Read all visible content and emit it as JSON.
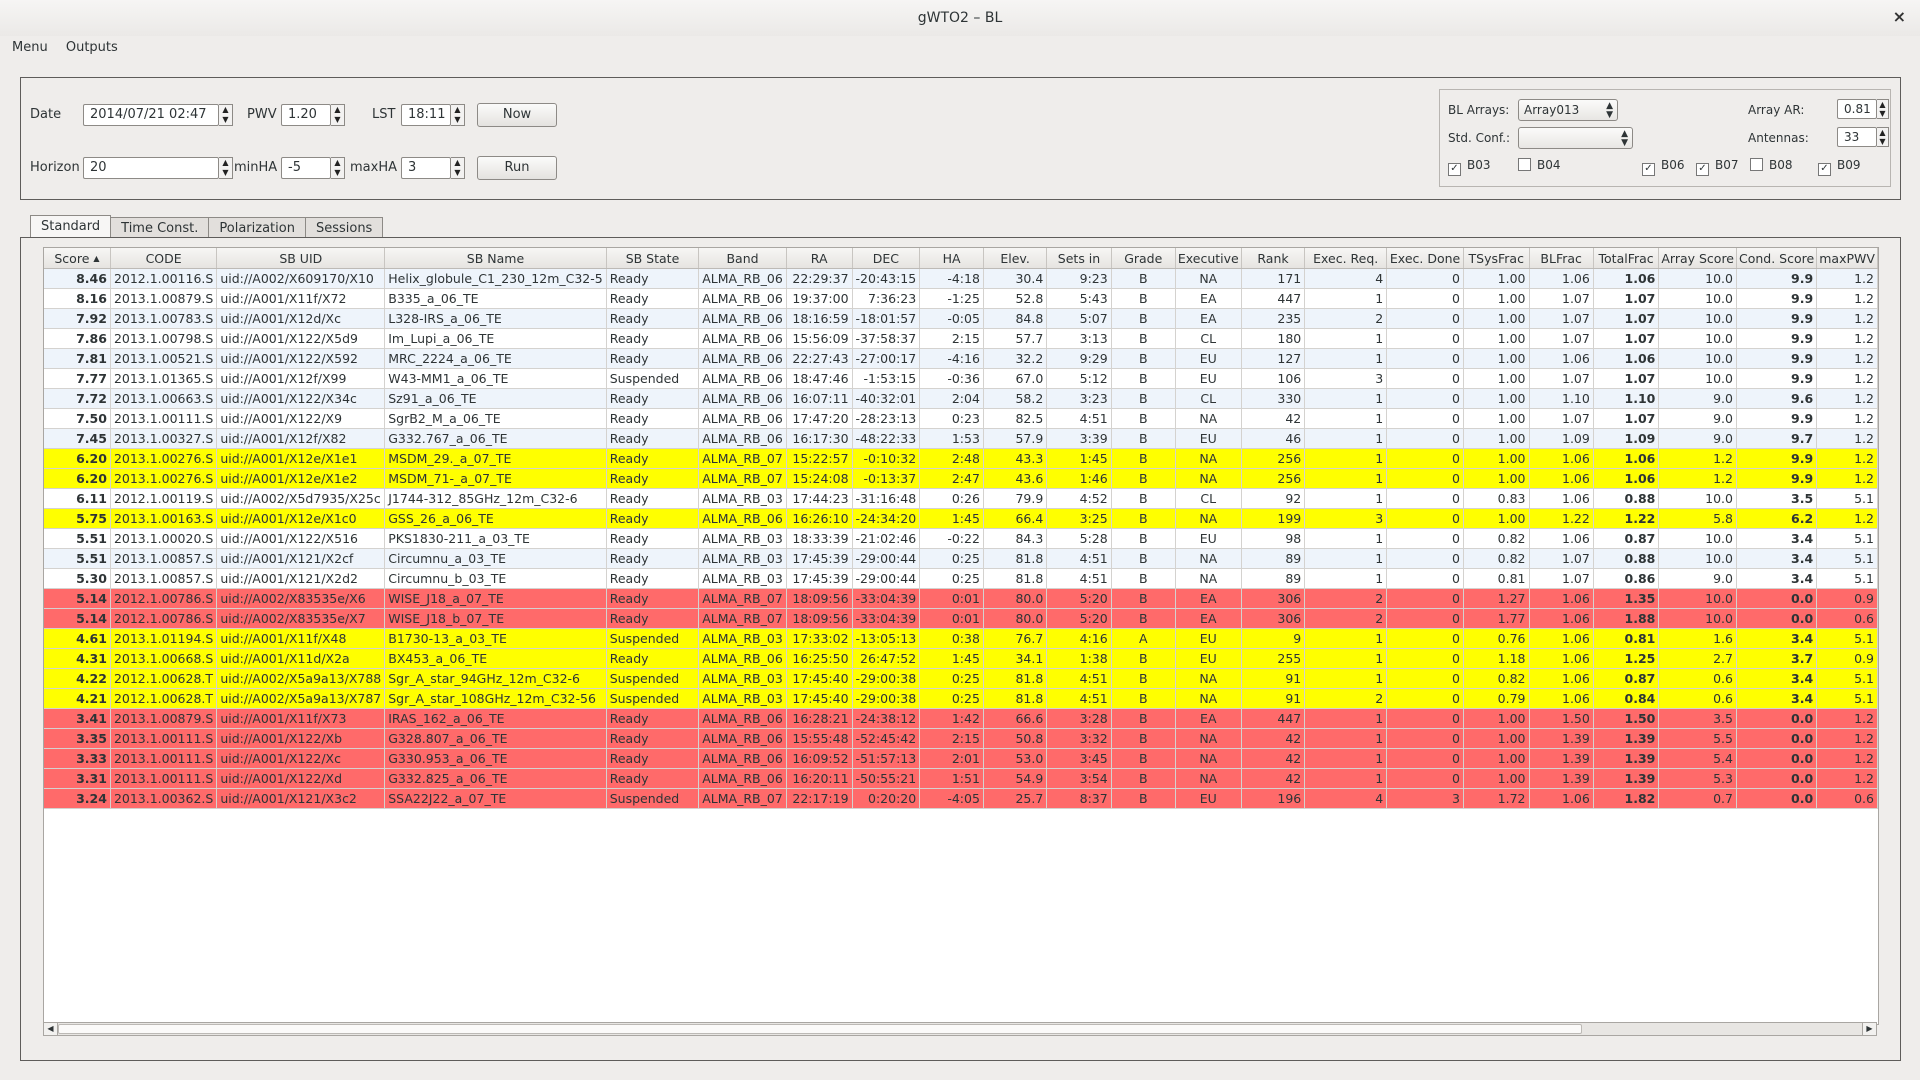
{
  "window": {
    "title": "gWTO2 – BL",
    "close_glyph": "×"
  },
  "menu": [
    "Menu",
    "Outputs"
  ],
  "controls": {
    "date_label": "Date",
    "date_value": "2014/07/21 02:47",
    "pwv_label": "PWV",
    "pwv_value": "1.20",
    "lst_label": "LST",
    "lst_value": "18:11",
    "now_button": "Now",
    "horizon_label": "Horizon",
    "horizon_value": "20",
    "minha_label": "minHA",
    "minha_value": "-5",
    "maxha_label": "maxHA",
    "maxha_value": "3",
    "run_button": "Run"
  },
  "bl_panel": {
    "arrays_label": "BL Arrays:",
    "arrays_value": "Array013",
    "std_conf_label": "Std. Conf.:",
    "std_conf_value": "",
    "array_ar_label": "Array AR:",
    "array_ar_value": "0.81",
    "antennas_label": "Antennas:",
    "antennas_value": "33",
    "checkboxes": [
      {
        "label": "B03",
        "checked": true
      },
      {
        "label": "B04",
        "checked": false
      },
      {
        "label": "B06",
        "checked": true
      },
      {
        "label": "B07",
        "checked": true
      },
      {
        "label": "B08",
        "checked": false
      },
      {
        "label": "B09",
        "checked": true
      }
    ]
  },
  "tabs": [
    "Standard",
    "Time Const.",
    "Polarization",
    "Sessions"
  ],
  "table": {
    "sort_indicator": "▲",
    "columns": [
      "Score",
      "CODE",
      "SB UID",
      "SB Name",
      "SB State",
      "Band",
      "RA",
      "DEC",
      "HA",
      "Elev.",
      "Sets in",
      "Grade",
      "Executive",
      "Rank",
      "Exec. Req.",
      "Exec. Done",
      "TSysFrac",
      "BLFrac",
      "TotalFrac",
      "Array Score",
      "Cond. Score",
      "maxPWV"
    ],
    "rows": [
      {
        "color": "alt",
        "cells": [
          "8.46",
          "2012.1.00116.S",
          "uid://A002/X609170/X10",
          "Helix_globule_C1_230_12m_C32-5",
          "Ready",
          "ALMA_RB_06",
          "22:29:37",
          "-20:43:15",
          "-4:18",
          "30.4",
          "9:23",
          "B",
          "NA",
          "171",
          "4",
          "0",
          "1.00",
          "1.06",
          "1.06",
          "10.0",
          "9.9",
          "1.2"
        ]
      },
      {
        "color": "plain",
        "cells": [
          "8.16",
          "2013.1.00879.S",
          "uid://A001/X11f/X72",
          "B335_a_06_TE",
          "Ready",
          "ALMA_RB_06",
          "19:37:00",
          "7:36:23",
          "-1:25",
          "52.8",
          "5:43",
          "B",
          "EA",
          "447",
          "1",
          "0",
          "1.00",
          "1.07",
          "1.07",
          "10.0",
          "9.9",
          "1.2"
        ]
      },
      {
        "color": "alt",
        "cells": [
          "7.92",
          "2013.1.00783.S",
          "uid://A001/X12d/Xc",
          "L328-IRS_a_06_TE",
          "Ready",
          "ALMA_RB_06",
          "18:16:59",
          "-18:01:57",
          "-0:05",
          "84.8",
          "5:07",
          "B",
          "EA",
          "235",
          "2",
          "0",
          "1.00",
          "1.07",
          "1.07",
          "10.0",
          "9.9",
          "1.2"
        ]
      },
      {
        "color": "plain",
        "cells": [
          "7.86",
          "2013.1.00798.S",
          "uid://A001/X122/X5d9",
          "Im_Lupi_a_06_TE",
          "Ready",
          "ALMA_RB_06",
          "15:56:09",
          "-37:58:37",
          "2:15",
          "57.7",
          "3:13",
          "B",
          "CL",
          "180",
          "1",
          "0",
          "1.00",
          "1.07",
          "1.07",
          "10.0",
          "9.9",
          "1.2"
        ]
      },
      {
        "color": "alt",
        "cells": [
          "7.81",
          "2013.1.00521.S",
          "uid://A001/X122/X592",
          "MRC_2224_a_06_TE",
          "Ready",
          "ALMA_RB_06",
          "22:27:43",
          "-27:00:17",
          "-4:16",
          "32.2",
          "9:29",
          "B",
          "EU",
          "127",
          "1",
          "0",
          "1.00",
          "1.06",
          "1.06",
          "10.0",
          "9.9",
          "1.2"
        ]
      },
      {
        "color": "plain",
        "cells": [
          "7.77",
          "2013.1.01365.S",
          "uid://A001/X12f/X99",
          "W43-MM1_a_06_TE",
          "Suspended",
          "ALMA_RB_06",
          "18:47:46",
          "-1:53:15",
          "-0:36",
          "67.0",
          "5:12",
          "B",
          "EU",
          "106",
          "3",
          "0",
          "1.00",
          "1.07",
          "1.07",
          "10.0",
          "9.9",
          "1.2"
        ]
      },
      {
        "color": "alt",
        "cells": [
          "7.72",
          "2013.1.00663.S",
          "uid://A001/X122/X34c",
          "Sz91_a_06_TE",
          "Ready",
          "ALMA_RB_06",
          "16:07:11",
          "-40:32:01",
          "2:04",
          "58.2",
          "3:23",
          "B",
          "CL",
          "330",
          "1",
          "0",
          "1.00",
          "1.10",
          "1.10",
          "9.0",
          "9.6",
          "1.2"
        ]
      },
      {
        "color": "plain",
        "cells": [
          "7.50",
          "2013.1.00111.S",
          "uid://A001/X122/X9",
          "SgrB2_M_a_06_TE",
          "Ready",
          "ALMA_RB_06",
          "17:47:20",
          "-28:23:13",
          "0:23",
          "82.5",
          "4:51",
          "B",
          "NA",
          "42",
          "1",
          "0",
          "1.00",
          "1.07",
          "1.07",
          "9.0",
          "9.9",
          "1.2"
        ]
      },
      {
        "color": "alt",
        "cells": [
          "7.45",
          "2013.1.00327.S",
          "uid://A001/X12f/X82",
          "G332.767_a_06_TE",
          "Ready",
          "ALMA_RB_06",
          "16:17:30",
          "-48:22:33",
          "1:53",
          "57.9",
          "3:39",
          "B",
          "EU",
          "46",
          "1",
          "0",
          "1.00",
          "1.09",
          "1.09",
          "9.0",
          "9.7",
          "1.2"
        ]
      },
      {
        "color": "yellow",
        "cells": [
          "6.20",
          "2013.1.00276.S",
          "uid://A001/X12e/X1e1",
          "MSDM_29._a_07_TE",
          "Ready",
          "ALMA_RB_07",
          "15:22:57",
          "-0:10:32",
          "2:48",
          "43.3",
          "1:45",
          "B",
          "NA",
          "256",
          "1",
          "0",
          "1.00",
          "1.06",
          "1.06",
          "1.2",
          "9.9",
          "1.2"
        ]
      },
      {
        "color": "yellow",
        "cells": [
          "6.20",
          "2013.1.00276.S",
          "uid://A001/X12e/X1e2",
          "MSDM_71-_a_07_TE",
          "Ready",
          "ALMA_RB_07",
          "15:24:08",
          "-0:13:37",
          "2:47",
          "43.6",
          "1:46",
          "B",
          "NA",
          "256",
          "1",
          "0",
          "1.00",
          "1.06",
          "1.06",
          "1.2",
          "9.9",
          "1.2"
        ]
      },
      {
        "color": "plain",
        "cells": [
          "6.11",
          "2012.1.00119.S",
          "uid://A002/X5d7935/X25c",
          "J1744-312_85GHz_12m_C32-6",
          "Ready",
          "ALMA_RB_03",
          "17:44:23",
          "-31:16:48",
          "0:26",
          "79.9",
          "4:52",
          "B",
          "CL",
          "92",
          "1",
          "0",
          "0.83",
          "1.06",
          "0.88",
          "10.0",
          "3.5",
          "5.1"
        ]
      },
      {
        "color": "yellow",
        "cells": [
          "5.75",
          "2013.1.00163.S",
          "uid://A001/X12e/X1c0",
          "GSS_26_a_06_TE",
          "Ready",
          "ALMA_RB_06",
          "16:26:10",
          "-24:34:20",
          "1:45",
          "66.4",
          "3:25",
          "B",
          "NA",
          "199",
          "3",
          "0",
          "1.00",
          "1.22",
          "1.22",
          "5.8",
          "6.2",
          "1.2"
        ]
      },
      {
        "color": "plain",
        "cells": [
          "5.51",
          "2013.1.00020.S",
          "uid://A001/X122/X516",
          "PKS1830-211_a_03_TE",
          "Ready",
          "ALMA_RB_03",
          "18:33:39",
          "-21:02:46",
          "-0:22",
          "84.3",
          "5:28",
          "B",
          "EU",
          "98",
          "1",
          "0",
          "0.82",
          "1.06",
          "0.87",
          "10.0",
          "3.4",
          "5.1"
        ]
      },
      {
        "color": "alt",
        "cells": [
          "5.51",
          "2013.1.00857.S",
          "uid://A001/X121/X2cf",
          "Circumnu_a_03_TE",
          "Ready",
          "ALMA_RB_03",
          "17:45:39",
          "-29:00:44",
          "0:25",
          "81.8",
          "4:51",
          "B",
          "NA",
          "89",
          "1",
          "0",
          "0.82",
          "1.07",
          "0.88",
          "10.0",
          "3.4",
          "5.1"
        ]
      },
      {
        "color": "plain",
        "cells": [
          "5.30",
          "2013.1.00857.S",
          "uid://A001/X121/X2d2",
          "Circumnu_b_03_TE",
          "Ready",
          "ALMA_RB_03",
          "17:45:39",
          "-29:00:44",
          "0:25",
          "81.8",
          "4:51",
          "B",
          "NA",
          "89",
          "1",
          "0",
          "0.81",
          "1.07",
          "0.86",
          "9.0",
          "3.4",
          "5.1"
        ]
      },
      {
        "color": "red",
        "cells": [
          "5.14",
          "2012.1.00786.S",
          "uid://A002/X83535e/X6",
          "WISE_J18_a_07_TE",
          "Ready",
          "ALMA_RB_07",
          "18:09:56",
          "-33:04:39",
          "0:01",
          "80.0",
          "5:20",
          "B",
          "EA",
          "306",
          "2",
          "0",
          "1.27",
          "1.06",
          "1.35",
          "10.0",
          "0.0",
          "0.9"
        ]
      },
      {
        "color": "red",
        "cells": [
          "5.14",
          "2012.1.00786.S",
          "uid://A002/X83535e/X7",
          "WISE_J18_b_07_TE",
          "Ready",
          "ALMA_RB_07",
          "18:09:56",
          "-33:04:39",
          "0:01",
          "80.0",
          "5:20",
          "B",
          "EA",
          "306",
          "2",
          "0",
          "1.77",
          "1.06",
          "1.88",
          "10.0",
          "0.0",
          "0.6"
        ]
      },
      {
        "color": "yellow",
        "cells": [
          "4.61",
          "2013.1.01194.S",
          "uid://A001/X11f/X48",
          "B1730-13_a_03_TE",
          "Suspended",
          "ALMA_RB_03",
          "17:33:02",
          "-13:05:13",
          "0:38",
          "76.7",
          "4:16",
          "A",
          "EU",
          "9",
          "1",
          "0",
          "0.76",
          "1.06",
          "0.81",
          "1.6",
          "3.4",
          "5.1"
        ]
      },
      {
        "color": "yellow",
        "cells": [
          "4.31",
          "2013.1.00668.S",
          "uid://A001/X11d/X2a",
          "BX453_a_06_TE",
          "Ready",
          "ALMA_RB_06",
          "16:25:50",
          "26:47:52",
          "1:45",
          "34.1",
          "1:38",
          "B",
          "EU",
          "255",
          "1",
          "0",
          "1.18",
          "1.06",
          "1.25",
          "2.7",
          "3.7",
          "0.9"
        ]
      },
      {
        "color": "yellow",
        "cells": [
          "4.22",
          "2012.1.00628.T",
          "uid://A002/X5a9a13/X788",
          "Sgr_A_star_94GHz_12m_C32-6",
          "Suspended",
          "ALMA_RB_03",
          "17:45:40",
          "-29:00:38",
          "0:25",
          "81.8",
          "4:51",
          "B",
          "NA",
          "91",
          "1",
          "0",
          "0.82",
          "1.06",
          "0.87",
          "0.6",
          "3.4",
          "5.1"
        ]
      },
      {
        "color": "yellow",
        "cells": [
          "4.21",
          "2012.1.00628.T",
          "uid://A002/X5a9a13/X787",
          "Sgr_A_star_108GHz_12m_C32-56",
          "Suspended",
          "ALMA_RB_03",
          "17:45:40",
          "-29:00:38",
          "0:25",
          "81.8",
          "4:51",
          "B",
          "NA",
          "91",
          "2",
          "0",
          "0.79",
          "1.06",
          "0.84",
          "0.6",
          "3.4",
          "5.1"
        ]
      },
      {
        "color": "red",
        "cells": [
          "3.41",
          "2013.1.00879.S",
          "uid://A001/X11f/X73",
          "IRAS_162_a_06_TE",
          "Ready",
          "ALMA_RB_06",
          "16:28:21",
          "-24:38:12",
          "1:42",
          "66.6",
          "3:28",
          "B",
          "EA",
          "447",
          "1",
          "0",
          "1.00",
          "1.50",
          "1.50",
          "3.5",
          "0.0",
          "1.2"
        ]
      },
      {
        "color": "red",
        "cells": [
          "3.35",
          "2013.1.00111.S",
          "uid://A001/X122/Xb",
          "G328.807_a_06_TE",
          "Ready",
          "ALMA_RB_06",
          "15:55:48",
          "-52:45:42",
          "2:15",
          "50.8",
          "3:32",
          "B",
          "NA",
          "42",
          "1",
          "0",
          "1.00",
          "1.39",
          "1.39",
          "5.5",
          "0.0",
          "1.2"
        ]
      },
      {
        "color": "red",
        "cells": [
          "3.33",
          "2013.1.00111.S",
          "uid://A001/X122/Xc",
          "G330.953_a_06_TE",
          "Ready",
          "ALMA_RB_06",
          "16:09:52",
          "-51:57:13",
          "2:01",
          "53.0",
          "3:45",
          "B",
          "NA",
          "42",
          "1",
          "0",
          "1.00",
          "1.39",
          "1.39",
          "5.4",
          "0.0",
          "1.2"
        ]
      },
      {
        "color": "red",
        "cells": [
          "3.31",
          "2013.1.00111.S",
          "uid://A001/X122/Xd",
          "G332.825_a_06_TE",
          "Ready",
          "ALMA_RB_06",
          "16:20:11",
          "-50:55:21",
          "1:51",
          "54.9",
          "3:54",
          "B",
          "NA",
          "42",
          "1",
          "0",
          "1.00",
          "1.39",
          "1.39",
          "5.3",
          "0.0",
          "1.2"
        ]
      },
      {
        "color": "red",
        "cells": [
          "3.24",
          "2013.1.00362.S",
          "uid://A001/X121/X3c2",
          "SSA22J22_a_07_TE",
          "Suspended",
          "ALMA_RB_07",
          "22:17:19",
          "0:20:20",
          "-4:05",
          "25.7",
          "8:37",
          "B",
          "EU",
          "196",
          "4",
          "3",
          "1.72",
          "1.06",
          "1.82",
          "0.7",
          "0.0",
          "0.6"
        ]
      }
    ]
  },
  "colors": {
    "yellow_row": "#ffff00",
    "red_row": "#ff6a6a",
    "alt_row": "#eef4fb"
  }
}
